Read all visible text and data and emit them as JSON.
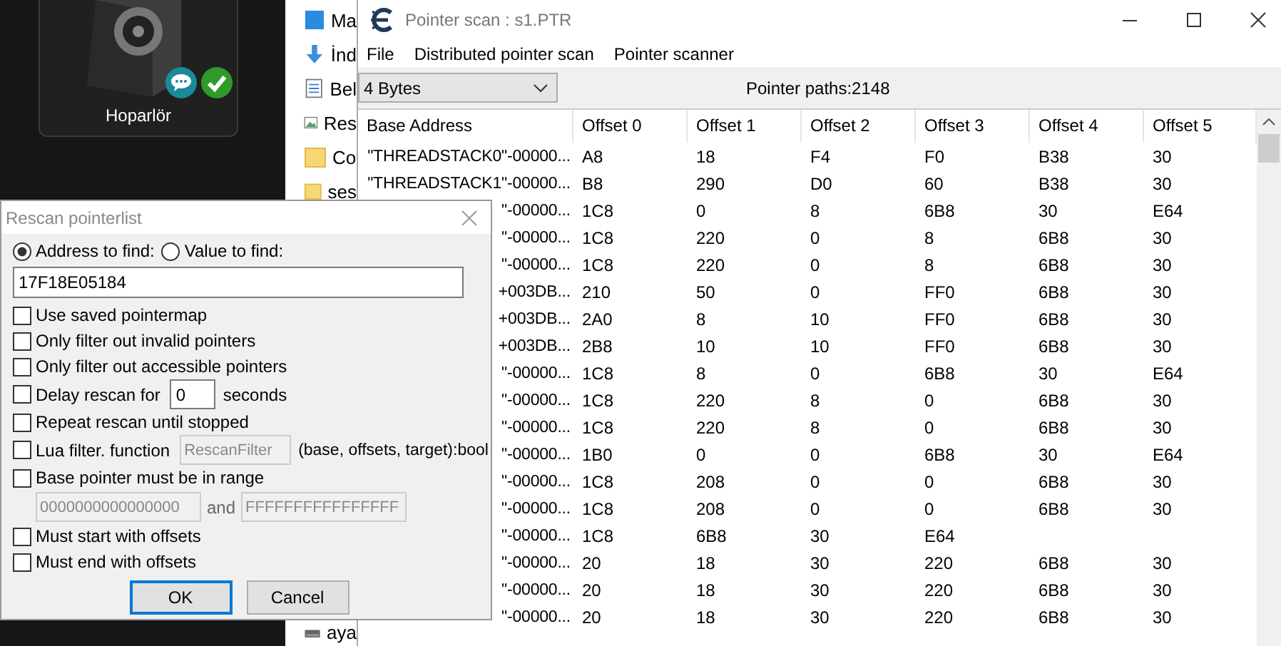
{
  "desktop_tile": {
    "label": "Hoparlör"
  },
  "explorer": {
    "items": [
      {
        "label": "Ma",
        "kind": "desktop"
      },
      {
        "label": "İnd",
        "kind": "download"
      },
      {
        "label": "Bel",
        "kind": "document"
      },
      {
        "label": "Res",
        "kind": "image"
      },
      {
        "label": "Co",
        "kind": "folder"
      },
      {
        "label": "ses",
        "kind": "folder"
      },
      {
        "label": "aya",
        "kind": "drive"
      }
    ]
  },
  "window": {
    "title": "Pointer scan : s1.PTR",
    "menu": [
      "File",
      "Distributed pointer scan",
      "Pointer scanner"
    ],
    "type_dropdown": {
      "value": "4 Bytes"
    },
    "pointer_paths": "Pointer paths:2148",
    "table": {
      "columns": [
        "Base Address",
        "Offset 0",
        "Offset 1",
        "Offset 2",
        "Offset 3",
        "Offset 4",
        "Offset 5"
      ],
      "rows": [
        {
          "base": "\"THREADSTACK0\"-00000...",
          "offsets": [
            "A8",
            "18",
            "F4",
            "F0",
            "B38",
            "30"
          ]
        },
        {
          "base": "\"THREADSTACK1\"-00000...",
          "offsets": [
            "B8",
            "290",
            "D0",
            "60",
            "B38",
            "30"
          ]
        },
        {
          "base": "\"-00000...",
          "offsets": [
            "1C8",
            "0",
            "8",
            "6B8",
            "30",
            "E64"
          ]
        },
        {
          "base": "\"-00000...",
          "offsets": [
            "1C8",
            "220",
            "0",
            "8",
            "6B8",
            "30"
          ]
        },
        {
          "base": "\"-00000...",
          "offsets": [
            "1C8",
            "220",
            "0",
            "8",
            "6B8",
            "30"
          ]
        },
        {
          "base": "+003DB...",
          "offsets": [
            "210",
            "50",
            "0",
            "FF0",
            "6B8",
            "30"
          ]
        },
        {
          "base": "+003DB...",
          "offsets": [
            "2A0",
            "8",
            "10",
            "FF0",
            "6B8",
            "30"
          ]
        },
        {
          "base": "+003DB...",
          "offsets": [
            "2B8",
            "10",
            "10",
            "FF0",
            "6B8",
            "30"
          ]
        },
        {
          "base": "\"-00000...",
          "offsets": [
            "1C8",
            "8",
            "0",
            "6B8",
            "30",
            "E64"
          ]
        },
        {
          "base": "\"-00000...",
          "offsets": [
            "1C8",
            "220",
            "8",
            "0",
            "6B8",
            "30"
          ]
        },
        {
          "base": "\"-00000...",
          "offsets": [
            "1C8",
            "220",
            "8",
            "0",
            "6B8",
            "30"
          ]
        },
        {
          "base": "\"-00000...",
          "offsets": [
            "1B0",
            "0",
            "0",
            "6B8",
            "30",
            "E64"
          ]
        },
        {
          "base": "\"-00000...",
          "offsets": [
            "1C8",
            "208",
            "0",
            "0",
            "6B8",
            "30"
          ]
        },
        {
          "base": "\"-00000...",
          "offsets": [
            "1C8",
            "208",
            "0",
            "0",
            "6B8",
            "30"
          ]
        },
        {
          "base": "\"-00000...",
          "offsets": [
            "1C8",
            "6B8",
            "30",
            "E64"
          ]
        },
        {
          "base": "\"-00000...",
          "offsets": [
            "20",
            "18",
            "30",
            "220",
            "6B8",
            "30"
          ]
        },
        {
          "base": "\"-00000...",
          "offsets": [
            "20",
            "18",
            "30",
            "220",
            "6B8",
            "30"
          ]
        },
        {
          "base": "\"-00000...",
          "offsets": [
            "20",
            "18",
            "30",
            "220",
            "6B8",
            "30"
          ]
        }
      ]
    }
  },
  "dialog": {
    "title": "Rescan pointerlist",
    "radios": [
      {
        "label": "Address to find:",
        "selected": true
      },
      {
        "label": "Value to find:",
        "selected": false
      }
    ],
    "address_value": "17F18E05184",
    "options": [
      {
        "kind": "check",
        "label": "Use saved pointermap",
        "checked": false
      },
      {
        "kind": "check",
        "label": "Only filter out invalid pointers",
        "checked": false
      },
      {
        "kind": "check",
        "label": "Only filter out accessible pointers",
        "checked": false
      },
      {
        "kind": "delay",
        "label": "Delay rescan for",
        "checked": false,
        "field": {
          "value": "0",
          "disabled": false
        },
        "suffix": "seconds"
      },
      {
        "kind": "check",
        "label": "Repeat rescan until stopped",
        "checked": false
      },
      {
        "kind": "lua",
        "label": "Lua filter. function",
        "checked": false,
        "field": {
          "value": "RescanFilter",
          "disabled": true
        },
        "suffix": "(base, offsets, target):bool"
      },
      {
        "kind": "range",
        "label": "Base pointer must be in range",
        "checked": false,
        "from": {
          "value": "0000000000000000",
          "disabled": true
        },
        "joiner": "and",
        "to": {
          "value": "FFFFFFFFFFFFFFFF",
          "disabled": true
        }
      },
      {
        "kind": "check",
        "label": "Must start with offsets",
        "checked": false
      },
      {
        "kind": "check",
        "label": "Must end with offsets",
        "checked": false
      }
    ],
    "buttons": [
      {
        "label": "OK",
        "default": true
      },
      {
        "label": "Cancel",
        "default": false
      }
    ]
  }
}
